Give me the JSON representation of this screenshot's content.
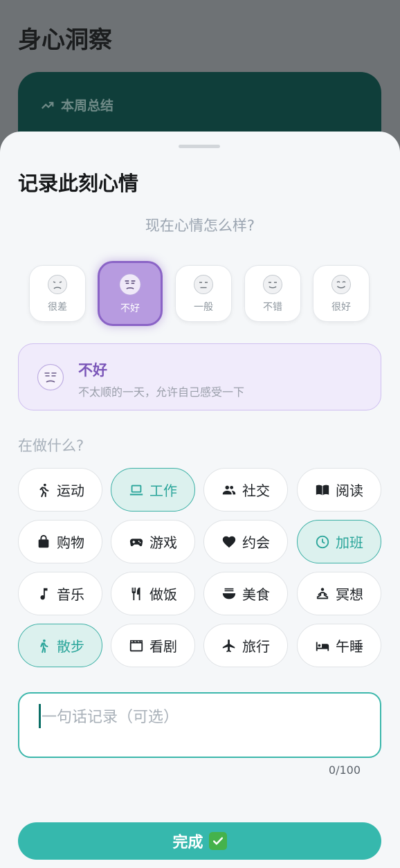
{
  "app": {
    "title": "身心洞察",
    "summary_card_title": "本周总结"
  },
  "sheet": {
    "title": "记录此刻心情",
    "question": "现在心情怎么样?",
    "moods": [
      {
        "label": "很差",
        "icon": "very-bad-face-icon"
      },
      {
        "label": "不好",
        "icon": "bad-face-icon",
        "selected": true
      },
      {
        "label": "一般",
        "icon": "neutral-face-icon"
      },
      {
        "label": "不错",
        "icon": "good-face-icon"
      },
      {
        "label": "很好",
        "icon": "very-good-face-icon"
      }
    ],
    "selected_mood": {
      "title": "不好",
      "description": "不太顺的一天，允许自己感受一下"
    },
    "activity_question": "在做什么?",
    "activities": [
      {
        "label": "运动",
        "icon": "running-icon",
        "selected": false
      },
      {
        "label": "工作",
        "icon": "laptop-icon",
        "selected": true
      },
      {
        "label": "社交",
        "icon": "people-icon",
        "selected": false
      },
      {
        "label": "阅读",
        "icon": "book-icon",
        "selected": false
      },
      {
        "label": "购物",
        "icon": "shopping-bag-icon",
        "selected": false
      },
      {
        "label": "游戏",
        "icon": "gamepad-icon",
        "selected": false
      },
      {
        "label": "约会",
        "icon": "heart-icon",
        "selected": false
      },
      {
        "label": "加班",
        "icon": "clock-icon",
        "selected": true
      },
      {
        "label": "音乐",
        "icon": "music-note-icon",
        "selected": false
      },
      {
        "label": "做饭",
        "icon": "utensils-icon",
        "selected": false
      },
      {
        "label": "美食",
        "icon": "bowl-icon",
        "selected": false
      },
      {
        "label": "冥想",
        "icon": "meditation-icon",
        "selected": false
      },
      {
        "label": "散步",
        "icon": "walking-icon",
        "selected": true
      },
      {
        "label": "看剧",
        "icon": "clapperboard-icon",
        "selected": false
      },
      {
        "label": "旅行",
        "icon": "airplane-icon",
        "selected": false
      },
      {
        "label": "午睡",
        "icon": "bed-icon",
        "selected": false
      }
    ],
    "note": {
      "placeholder": "一句话记录（可选）",
      "counter": "0/100"
    },
    "done_label": "完成"
  },
  "colors": {
    "accent": "#36b8ad",
    "mood_accent": "#8a63c6",
    "selected_chip_bg": "#dcf1ee"
  }
}
